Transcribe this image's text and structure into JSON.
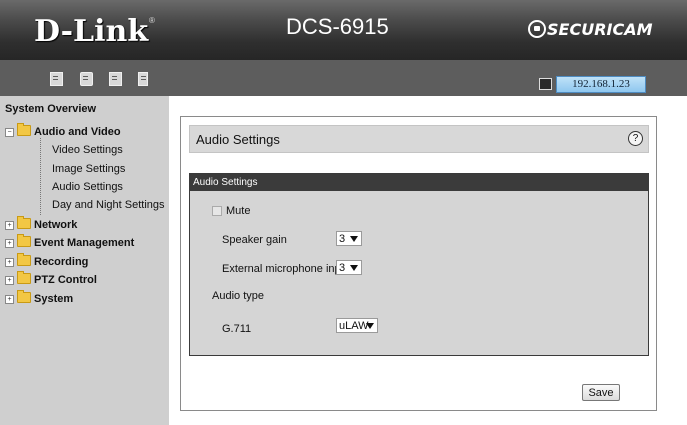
{
  "header": {
    "logo": "D-Link",
    "logo_mark": "®",
    "model": "DCS-6915",
    "brand": "SECURICAM"
  },
  "toolbar": {
    "ip_address": "192.168.1.23"
  },
  "sidebar": {
    "title": "System Overview",
    "groups": [
      {
        "label": "Audio and Video",
        "expanded": true
      },
      {
        "label": "Network"
      },
      {
        "label": "Event Management"
      },
      {
        "label": "Recording"
      },
      {
        "label": "PTZ Control"
      },
      {
        "label": "System"
      }
    ],
    "sub_items": [
      "Video Settings",
      "Image Settings",
      "Audio Settings",
      "Day and Night Settings"
    ]
  },
  "main": {
    "title": "Audio Settings",
    "help": "?",
    "section_title": "Audio Settings",
    "mute_label": "Mute",
    "speaker_gain_label": "Speaker gain",
    "speaker_gain_value": "3",
    "mic_input_label": "External microphone input",
    "mic_input_value": "3",
    "audio_type_label": "Audio type",
    "codec_label": "G.711",
    "codec_value": "uLAW",
    "save_label": "Save"
  }
}
